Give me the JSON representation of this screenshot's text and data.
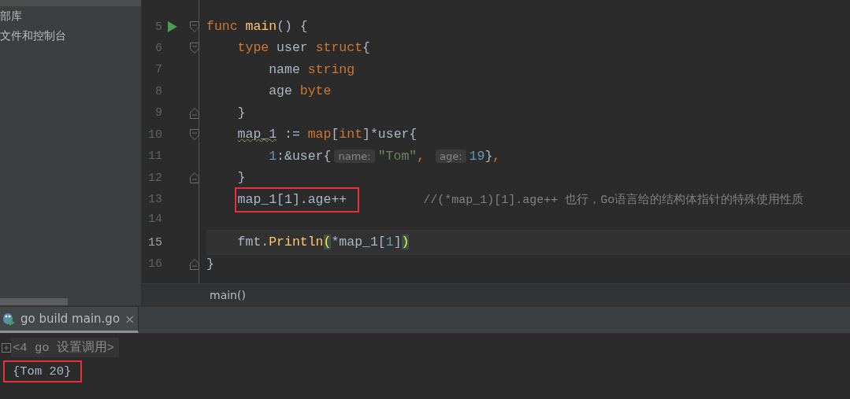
{
  "sidebar": {
    "items": [
      {
        "label": "部库",
        "selected": false
      },
      {
        "label": "文件和控制台",
        "selected": false
      }
    ]
  },
  "editor": {
    "lines": [
      {
        "number": "5",
        "runnable": true,
        "fold_open": true,
        "fold_close": false,
        "current": false,
        "boxed": false,
        "code": [
          {
            "kind": "keyword",
            "text": "func "
          },
          {
            "kind": "func",
            "text": "main"
          },
          {
            "kind": "plain",
            "text": "() {"
          }
        ]
      },
      {
        "number": "6",
        "runnable": false,
        "fold_open": true,
        "fold_close": false,
        "current": false,
        "boxed": false,
        "code": [
          {
            "kind": "keyword",
            "text": "    type "
          },
          {
            "kind": "plain",
            "text": "user "
          },
          {
            "kind": "keyword",
            "text": "struct"
          },
          {
            "kind": "plain",
            "text": "{"
          }
        ]
      },
      {
        "number": "7",
        "runnable": false,
        "fold_open": false,
        "fold_close": false,
        "current": false,
        "boxed": false,
        "code": [
          {
            "kind": "plain",
            "text": "        name "
          },
          {
            "kind": "keyword",
            "text": "string"
          }
        ]
      },
      {
        "number": "8",
        "runnable": false,
        "fold_open": false,
        "fold_close": false,
        "current": false,
        "boxed": false,
        "code": [
          {
            "kind": "plain",
            "text": "        age "
          },
          {
            "kind": "keyword",
            "text": "byte"
          }
        ]
      },
      {
        "number": "9",
        "runnable": false,
        "fold_open": false,
        "fold_close": true,
        "current": false,
        "boxed": false,
        "code": [
          {
            "kind": "plain",
            "text": "    }"
          }
        ]
      },
      {
        "number": "10",
        "runnable": false,
        "fold_open": true,
        "fold_close": false,
        "current": false,
        "boxed": false,
        "code": [
          {
            "kind": "warn",
            "text": "    map_1"
          },
          {
            "kind": "plain",
            "text": " := "
          },
          {
            "kind": "keyword",
            "text": "map"
          },
          {
            "kind": "plain",
            "text": "["
          },
          {
            "kind": "keyword",
            "text": "int"
          },
          {
            "kind": "plain",
            "text": "]*user{"
          }
        ]
      },
      {
        "number": "11",
        "runnable": false,
        "fold_open": false,
        "fold_close": false,
        "current": false,
        "boxed": false,
        "code": [
          {
            "kind": "number",
            "text": "        1"
          },
          {
            "kind": "plain",
            "text": ":&user{"
          },
          {
            "kind": "hint",
            "text": "name:"
          },
          {
            "kind": "string",
            "text": "\"Tom\""
          },
          {
            "kind": "keyword",
            "text": ", "
          },
          {
            "kind": "hint",
            "text": "age:"
          },
          {
            "kind": "number",
            "text": "19"
          },
          {
            "kind": "plain",
            "text": "}"
          },
          {
            "kind": "keyword",
            "text": ","
          }
        ]
      },
      {
        "number": "12",
        "runnable": false,
        "fold_open": false,
        "fold_close": true,
        "current": false,
        "boxed": false,
        "code": [
          {
            "kind": "plain",
            "text": "    }"
          }
        ]
      },
      {
        "number": "13",
        "runnable": false,
        "fold_open": false,
        "fold_close": false,
        "current": false,
        "boxed": true,
        "code": [
          {
            "kind": "plain",
            "text": "    map_1[1].age++"
          }
        ],
        "comment": "//(*map_1)[1].age++ 也行，Go语言给的结构体指针的特殊使用性质"
      },
      {
        "number": "14",
        "runnable": false,
        "fold_open": false,
        "fold_close": false,
        "current": false
      },
      {
        "number": "15",
        "runnable": false,
        "fold_open": false,
        "fold_close": false,
        "current": true,
        "boxed": false,
        "code": [
          {
            "kind": "plain",
            "text": "    fmt."
          },
          {
            "kind": "func",
            "text": "Println"
          },
          {
            "kind": "paren",
            "text": "("
          },
          {
            "kind": "plain",
            "text": "*map_1["
          },
          {
            "kind": "number",
            "text": "1"
          },
          {
            "kind": "plain",
            "text": "]"
          },
          {
            "kind": "paren",
            "text": ")"
          }
        ]
      },
      {
        "number": "16",
        "runnable": false,
        "fold_open": false,
        "fold_close": true,
        "current": false,
        "boxed": false,
        "code": [
          {
            "kind": "plain",
            "text": "}"
          }
        ]
      }
    ]
  },
  "breadcrumb": "main()",
  "run_tabs": [
    {
      "label": "go build main.go",
      "close": "×",
      "selected": true
    }
  ],
  "console": {
    "lines": [
      {
        "kind": "folded",
        "text": "<4 go 设置调用>",
        "boxed": false
      },
      {
        "kind": "output",
        "text": "{Tom 20}",
        "boxed": true
      }
    ]
  }
}
